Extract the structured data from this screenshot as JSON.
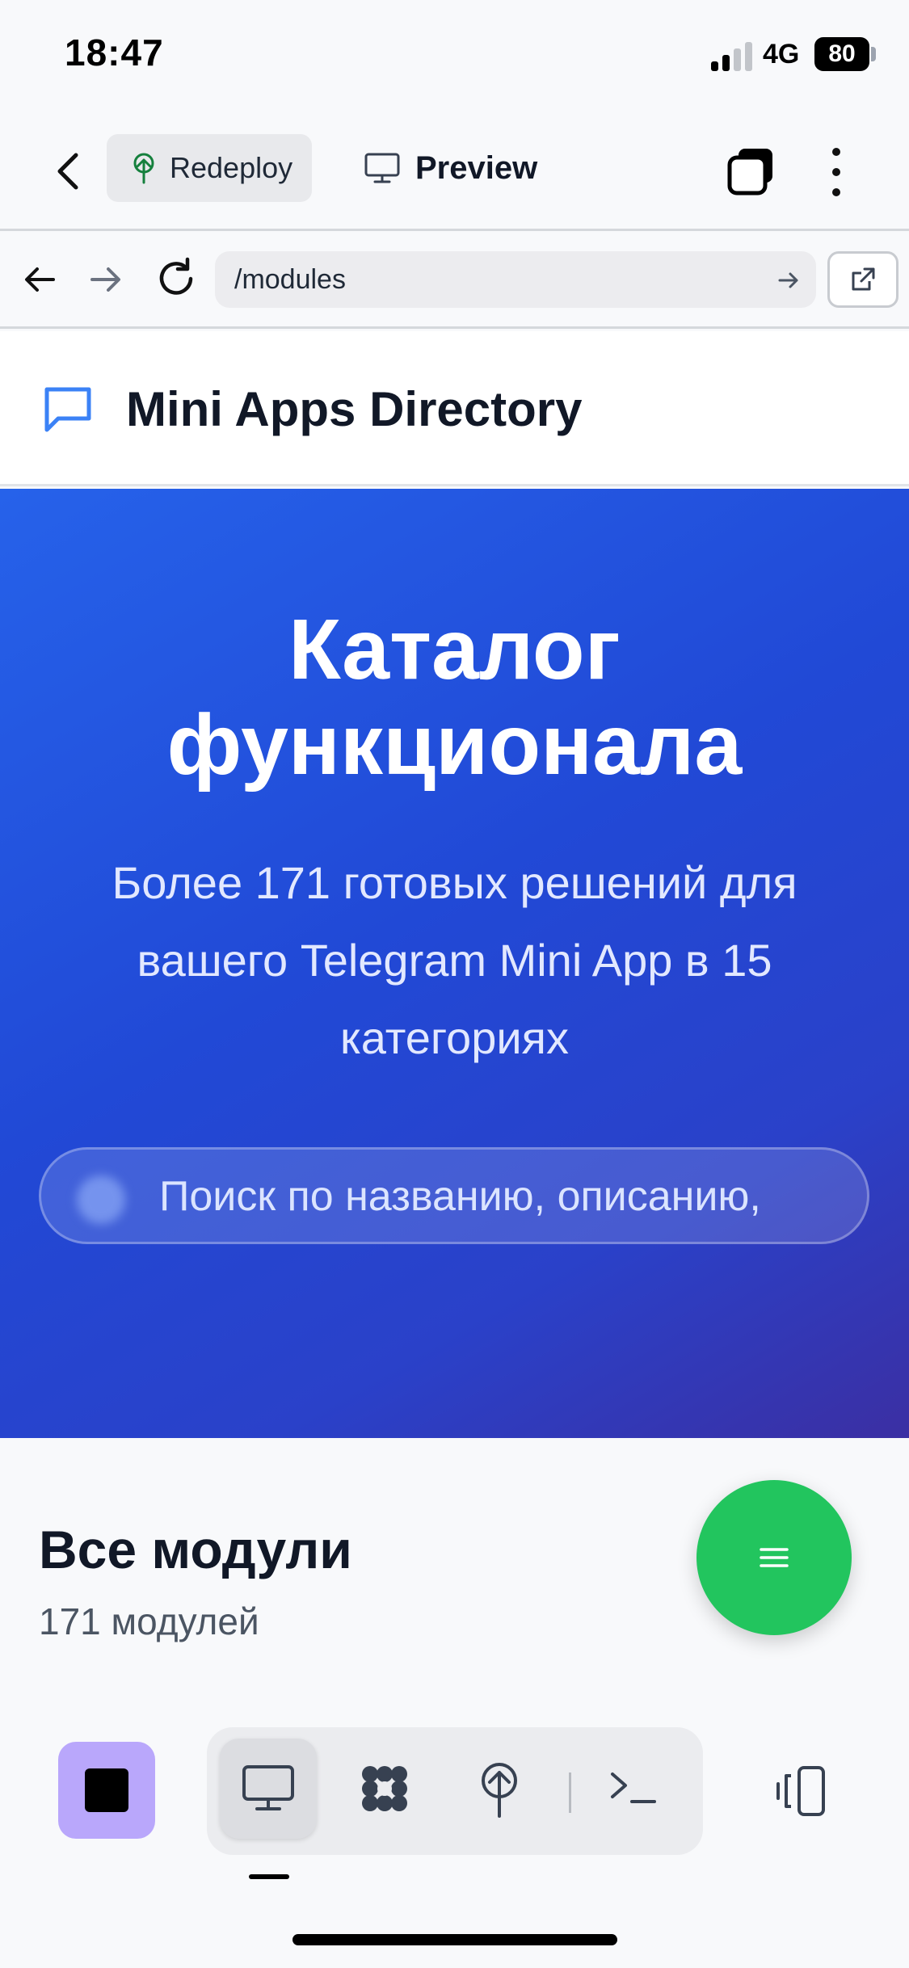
{
  "status_bar": {
    "time": "18:47",
    "network": "4G",
    "battery": "80"
  },
  "app_toolbar": {
    "redeploy_label": "Redeploy",
    "preview_label": "Preview",
    "icons": {
      "back": "chevron-left-icon",
      "redeploy": "tree-upload-icon",
      "preview": "monitor-icon",
      "stack": "stack-icon",
      "more": "more-vertical-icon"
    }
  },
  "browser": {
    "url": "/modules",
    "icons": {
      "back": "arrow-left-icon",
      "forward": "arrow-right-icon",
      "reload": "reload-icon",
      "go": "arrow-right-icon",
      "open_external": "external-link-icon"
    }
  },
  "site": {
    "title": "Mini Apps Directory",
    "logo_icon": "chat-bubble-icon"
  },
  "hero": {
    "title_line1": "Каталог",
    "title_line2": "функционала",
    "subtitle_line1": "Более 171 готовых решений для",
    "subtitle_line2": "вашего Telegram Mini App в 15",
    "subtitle_line3": "категориях",
    "search_placeholder": "Поиск по названию, описанию,"
  },
  "modules": {
    "title": "Все модули",
    "count": "171 модулей"
  },
  "fab": {
    "icon": "menu-icon"
  },
  "dock": {
    "stop_icon": "stop-icon",
    "tabs": [
      "monitor-icon",
      "grid-flower-icon",
      "tree-upload-icon",
      "terminal-icon"
    ],
    "active_tab": "monitor-icon",
    "device_icon": "device-switch-icon"
  },
  "colors": {
    "hero_start": "#2662ea",
    "hero_end": "#3b2fa3",
    "fab": "#22c55e",
    "stop_bg": "#b9a7fb"
  }
}
